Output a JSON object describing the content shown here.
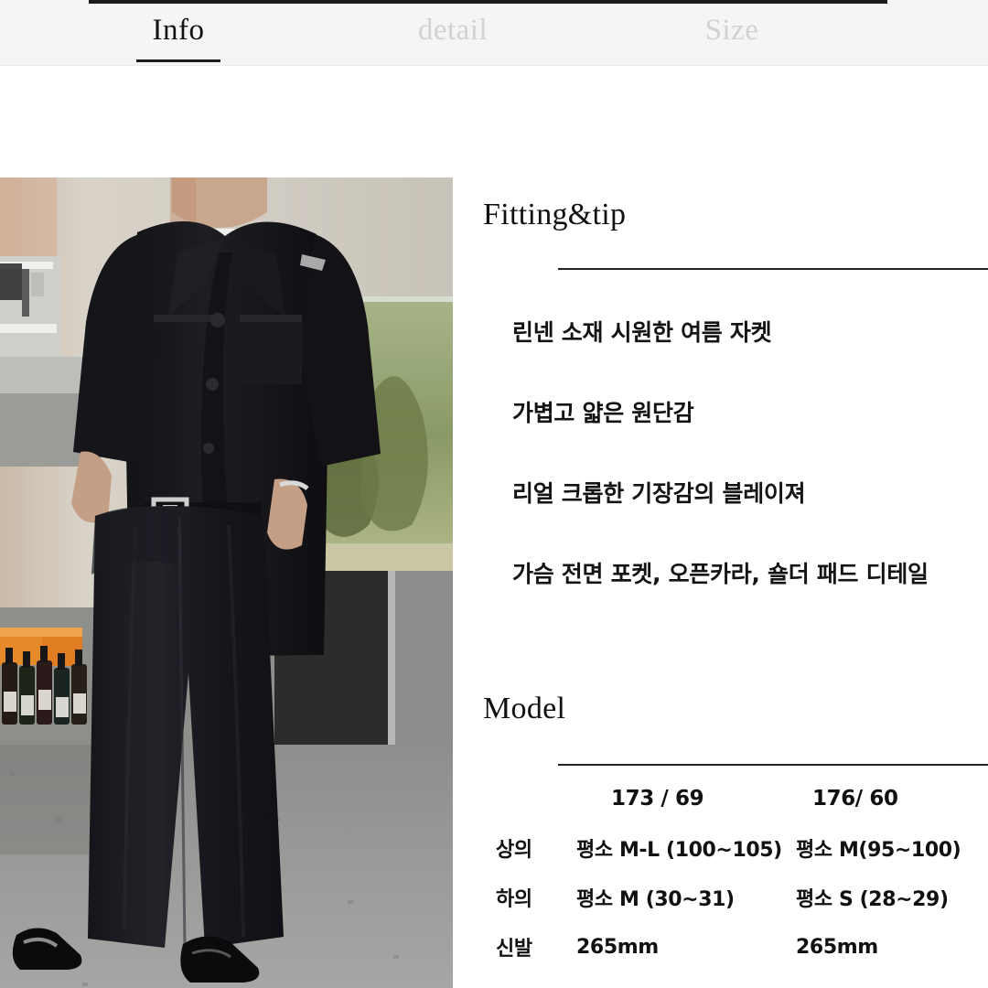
{
  "tabs": [
    {
      "label": "Info",
      "active": true,
      "name": "tab-info"
    },
    {
      "label": "detail",
      "active": false,
      "name": "tab-detail"
    },
    {
      "label": "Size",
      "active": false,
      "name": "tab-size"
    }
  ],
  "photo": {
    "alt": "Model wearing black short-sleeve linen blazer over white tee with black wide-leg trousers and black patent loafers, standing in a bar interior beside an aquarium",
    "colors": {
      "garment_black": "#141414",
      "wall_beige": "#b9b2a6",
      "wall_light": "#d9d6cf",
      "aquarium_green": "#7f8c5c",
      "floor_gray": "#9a9a98",
      "skin": "#caa98f",
      "tee_white": "#efefef"
    }
  },
  "fitting": {
    "title": "Fitting&tip",
    "bullets": [
      "린넨 소재 시원한 여름 자켓",
      "가볍고 얇은 원단감",
      "리얼 크롭한 기장감의 블레이져",
      "가슴 전면 포켓, 오픈카라, 숄더 패드 디테일"
    ]
  },
  "model": {
    "title": "Model",
    "columns": [
      "",
      "173 / 69",
      "176/ 60"
    ],
    "rows": [
      {
        "label": "상의",
        "a": "평소 M-L (100~105)",
        "b": "평소 M(95~100)"
      },
      {
        "label": "하의",
        "a": "평소 M (30~31)",
        "b": "평소 S (28~29)"
      },
      {
        "label": "신발",
        "a": "265mm",
        "b": "265mm"
      }
    ]
  },
  "theme": {
    "accent": "#1b1b1b",
    "tabbar_bg": "#f5f5f5",
    "inactive_tab": "#d2d2d2",
    "text": "#111111",
    "rule": "#232323"
  }
}
